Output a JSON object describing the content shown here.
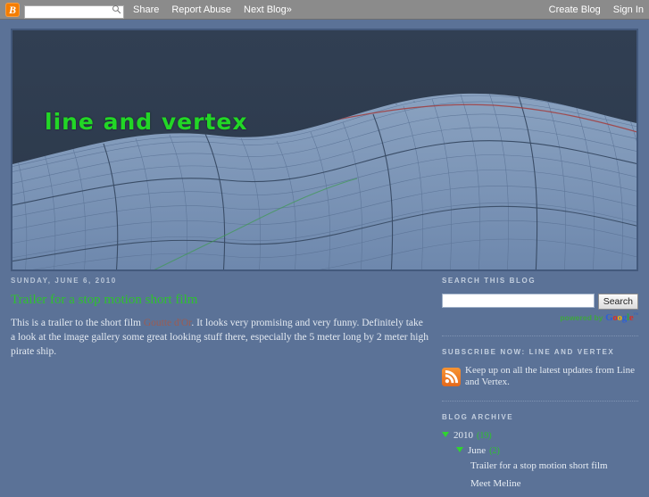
{
  "navbar": {
    "logo_alt": "B",
    "search_placeholder": "",
    "search_value": "",
    "links": [
      {
        "label": "Share"
      },
      {
        "label": "Report Abuse"
      },
      {
        "label": "Next Blog»"
      }
    ],
    "right_links": [
      {
        "label": "Create Blog"
      },
      {
        "label": "Sign In"
      }
    ]
  },
  "header": {
    "blog_title": "line and vertex",
    "sky_color": "#2e3c4f",
    "mesh_color": "#7b93b5",
    "title_color": "#22d726"
  },
  "post": {
    "date": "SUNDAY, JUNE 6, 2010",
    "title": "Trailer for a stop motion short film",
    "body_part1": "This is a trailer to the short film ",
    "body_link": "Goutte d'Or",
    "body_part2": ". It looks very promising and very funny. Definitely take a look at the image gallery some great looking stuff there, especially the 5 meter long by 2 meter high pirate ship."
  },
  "sidebar": {
    "search": {
      "title": "SEARCH THIS BLOG",
      "input_value": "",
      "input_placeholder": "",
      "button_label": "Search",
      "powered_by": "powered by",
      "google_letters": [
        "G",
        "o",
        "o",
        "g",
        "l",
        "e"
      ],
      "google_tm": "™"
    },
    "subscribe": {
      "title": "SUBSCRIBE NOW: LINE AND VERTEX",
      "icon": "rss-icon",
      "text": "Keep up on all the latest updates from Line and Vertex."
    },
    "archive": {
      "title": "BLOG ARCHIVE",
      "year": {
        "label": "2010",
        "count": "(19)"
      },
      "month": {
        "label": "June",
        "count": "(2)"
      },
      "posts": [
        {
          "label": "Trailer for a stop motion short film"
        },
        {
          "label": "Meet Meline"
        }
      ]
    }
  },
  "colors": {
    "page_background": "#5b7297",
    "navbar_background": "#8b8b8b",
    "accent_green": "#2fc12f",
    "blogger_orange": "#f57d00",
    "rss_orange": "#ee802a"
  }
}
